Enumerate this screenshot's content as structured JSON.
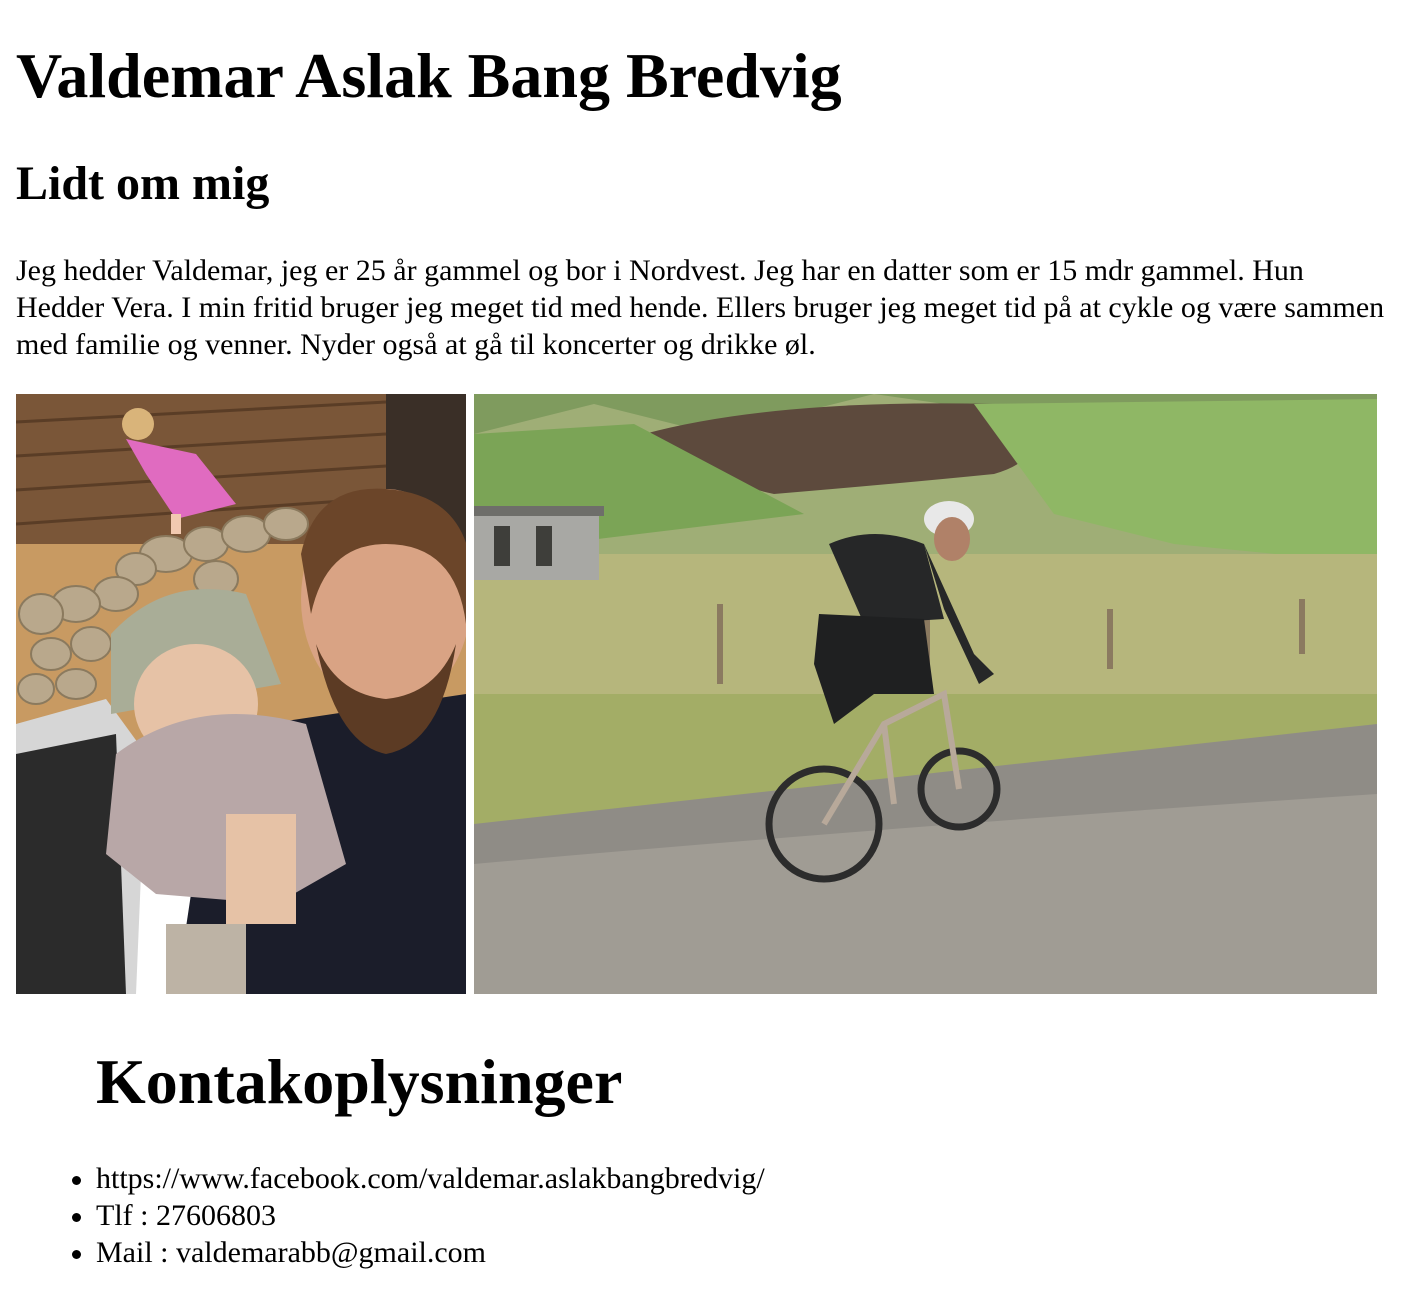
{
  "profile": {
    "name": "Valdemar Aslak Bang Bredvig",
    "about_heading": "Lidt om mig",
    "about_text": "Jeg hedder Valdemar, jeg er 25 år gammel og bor i Nordvest. Jeg har en datter som er 15 mdr gammel. Hun Hedder Vera. I min fritid bruger jeg meget tid med hende. Ellers bruger jeg meget tid på at cykle og være sammen med familie og venner. Nyder også at gå til koncerter og drikke øl."
  },
  "contact": {
    "heading": "Kontakoplysninger",
    "items": [
      "https://www.facebook.com/valdemar.aslakbangbredvig/",
      "Tlf : 27606803",
      "Mail : valdemarabb@gmail.com"
    ]
  }
}
